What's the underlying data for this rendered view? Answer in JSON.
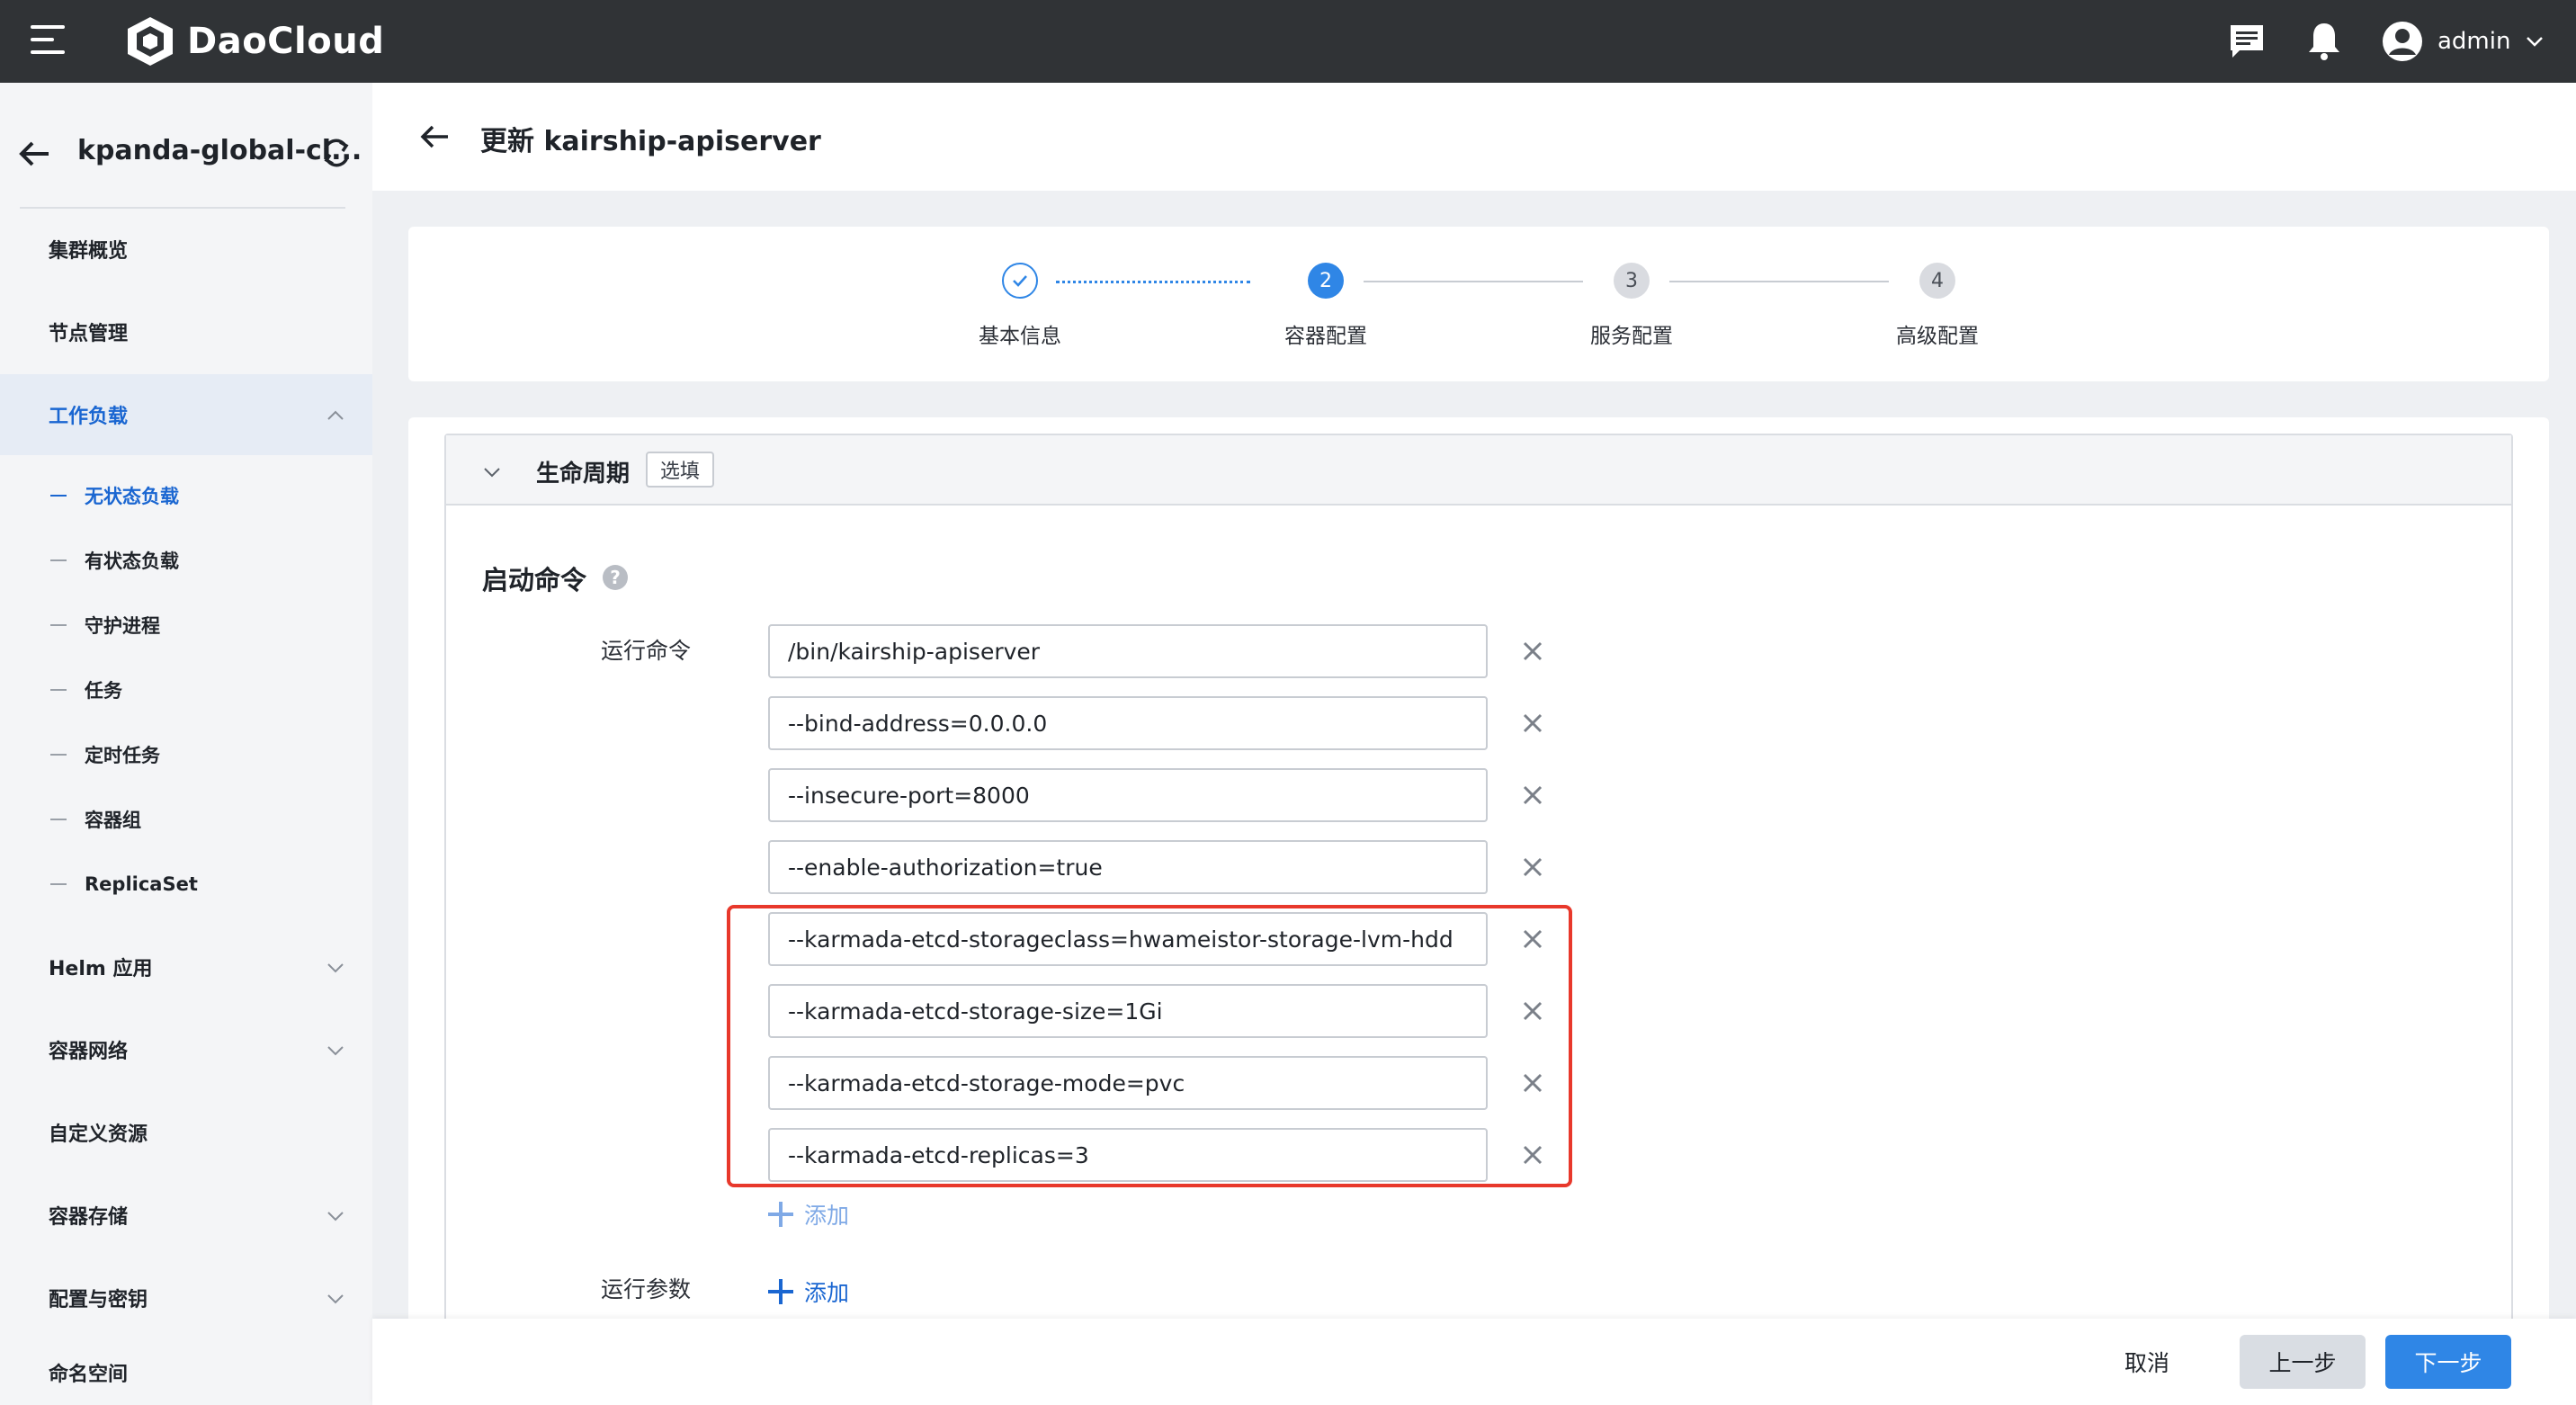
{
  "topbar": {
    "menu_icon": "hamburger-menu-icon",
    "brand": "DaoCloud",
    "message_icon": "message-icon",
    "bell_icon": "bell-icon",
    "user_name": "admin",
    "bg_color": "#303336"
  },
  "sidebar": {
    "cluster_name": "kpanda-global-cl...",
    "items": [
      {
        "label": "集群概览"
      },
      {
        "label": "节点管理"
      },
      {
        "label": "工作负载"
      },
      {
        "label": "Helm 应用"
      },
      {
        "label": "容器网络"
      },
      {
        "label": "自定义资源"
      },
      {
        "label": "容器存储"
      },
      {
        "label": "配置与密钥"
      },
      {
        "label": "命名空间"
      }
    ],
    "sub_items": [
      {
        "label": "无状态负载"
      },
      {
        "label": "有状态负载"
      },
      {
        "label": "守护进程"
      },
      {
        "label": "任务"
      },
      {
        "label": "定时任务"
      },
      {
        "label": "容器组"
      },
      {
        "label": "ReplicaSet"
      }
    ],
    "active_color": "#1a66d1"
  },
  "header": {
    "title": "更新 kairship-apiserver"
  },
  "steps": [
    {
      "number": "1",
      "label": "基本信息",
      "state": "done"
    },
    {
      "number": "2",
      "label": "容器配置",
      "state": "current"
    },
    {
      "number": "3",
      "label": "服务配置",
      "state": "todo"
    },
    {
      "number": "4",
      "label": "高级配置",
      "state": "todo"
    }
  ],
  "lifecycle": {
    "title": "生命周期",
    "badge": "选填",
    "start_command_title": "启动命令",
    "run_command_label": "运行命令",
    "run_args_label": "运行参数",
    "commands": [
      "/bin/kairship-apiserver",
      "--bind-address=0.0.0.0",
      "--insecure-port=8000",
      "--enable-authorization=true",
      "--karmada-etcd-storageclass=hwameistor-storage-lvm-hdd",
      "--karmada-etcd-storage-size=1Gi",
      "--karmada-etcd-storage-mode=pvc",
      "--karmada-etcd-replicas=3"
    ],
    "add_label": "添加",
    "highlight_color": "#e8382b"
  },
  "footer": {
    "cancel": "取消",
    "prev": "上一步",
    "next": "下一步",
    "primary_color": "#2f86e6"
  }
}
